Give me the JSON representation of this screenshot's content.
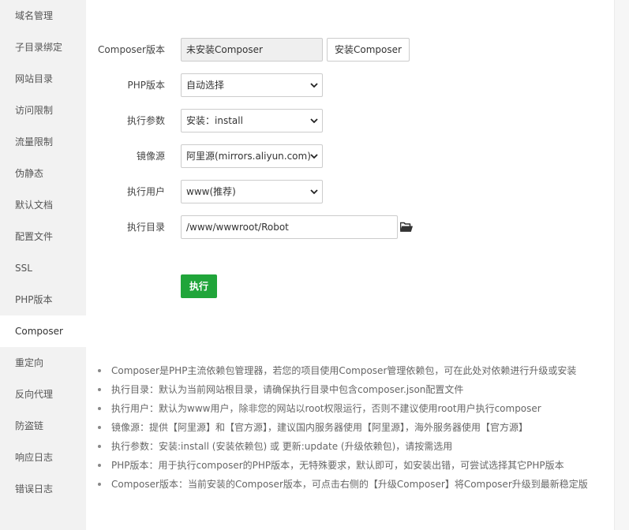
{
  "sidebar": {
    "items": [
      {
        "label": "域名管理",
        "active": false
      },
      {
        "label": "子目录绑定",
        "active": false
      },
      {
        "label": "网站目录",
        "active": false
      },
      {
        "label": "访问限制",
        "active": false
      },
      {
        "label": "流量限制",
        "active": false
      },
      {
        "label": "伪静态",
        "active": false
      },
      {
        "label": "默认文档",
        "active": false
      },
      {
        "label": "配置文件",
        "active": false
      },
      {
        "label": "SSL",
        "active": false
      },
      {
        "label": "PHP版本",
        "active": false
      },
      {
        "label": "Composer",
        "active": true
      },
      {
        "label": "重定向",
        "active": false
      },
      {
        "label": "反向代理",
        "active": false
      },
      {
        "label": "防盗链",
        "active": false
      },
      {
        "label": "响应日志",
        "active": false
      },
      {
        "label": "错误日志",
        "active": false
      }
    ]
  },
  "form": {
    "composer_version": {
      "label": "Composer版本",
      "value": "未安装Composer",
      "button": "安装Composer"
    },
    "php_version": {
      "label": "PHP版本",
      "value": "自动选择"
    },
    "exec_params": {
      "label": "执行参数",
      "value": "安装：install"
    },
    "mirror": {
      "label": "镜像源",
      "value": "阿里源(mirrors.aliyun.com)"
    },
    "exec_user": {
      "label": "执行用户",
      "value": "www(推荐)"
    },
    "exec_dir": {
      "label": "执行目录",
      "value": "/www/wwwroot/Robot"
    },
    "run_button": "执行"
  },
  "tips": [
    "Composer是PHP主流依赖包管理器，若您的项目使用Composer管理依赖包，可在此处对依赖进行升级或安装",
    "执行目录：默认为当前网站根目录，请确保执行目录中包含composer.json配置文件",
    "执行用户：默认为www用户，除非您的网站以root权限运行，否则不建议使用root用户执行composer",
    "镜像源：提供【阿里源】和【官方源】，建议国内服务器使用【阿里源】，海外服务器使用【官方源】",
    "执行参数：安装:install (安装依赖包) 或 更新:update (升级依赖包)，请按需选用",
    "PHP版本：用于执行composer的PHP版本，无特殊要求，默认即可，如安装出错，可尝试选择其它PHP版本",
    "Composer版本：当前安装的Composer版本，可点击右侧的【升级Composer】将Composer升级到最新稳定版"
  ],
  "colors": {
    "accent": "#20a53a",
    "sidebar_bg": "#f2f2f2"
  },
  "icons": {
    "select_arrow": "chevron-down-icon",
    "folder": "folder-open-icon"
  }
}
